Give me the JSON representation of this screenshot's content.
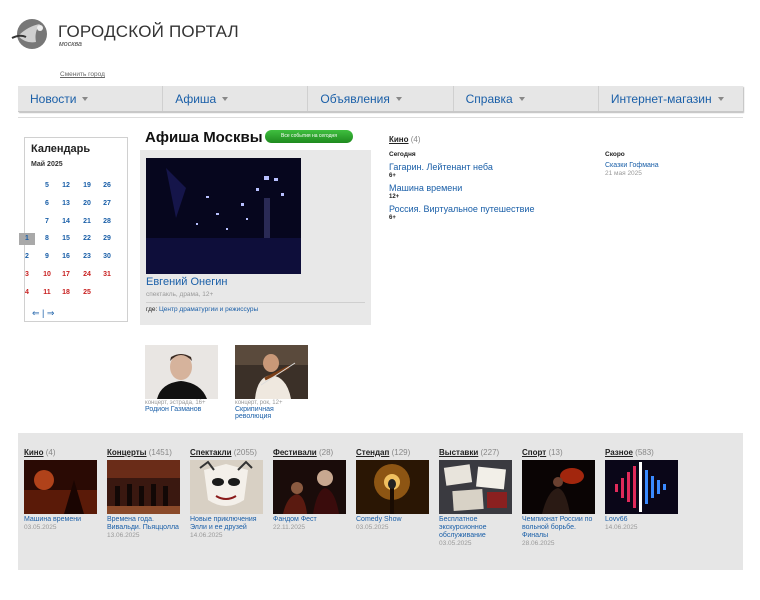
{
  "header": {
    "site_title": "ГОРОДСКОЙ ПОРТАЛ",
    "city": "москва",
    "change_city": "Сменить город"
  },
  "nav": {
    "items": [
      {
        "label": "Новости"
      },
      {
        "label": "Афиша"
      },
      {
        "label": "Объявления"
      },
      {
        "label": "Справка"
      },
      {
        "label": "Интернет-магазин"
      }
    ]
  },
  "calendar": {
    "title": "Календарь",
    "month": "Май 2025",
    "rows": [
      [
        "",
        "5",
        "12",
        "19",
        "26"
      ],
      [
        "",
        "6",
        "13",
        "20",
        "27"
      ],
      [
        "",
        "7",
        "14",
        "21",
        "28"
      ],
      [
        "1",
        "8",
        "15",
        "22",
        "29"
      ],
      [
        "2",
        "9",
        "16",
        "23",
        "30"
      ],
      [
        "3",
        "10",
        "17",
        "24",
        "31"
      ],
      [
        "4",
        "11",
        "18",
        "25",
        ""
      ]
    ],
    "selected": "1",
    "nav_symbol": "⇐ | ⇒"
  },
  "afisha": {
    "title": "Афиша Москвы",
    "all_today": "Все события на сегодня",
    "feature": {
      "title": "Евгений Онегин",
      "meta": "спектакль, драма, 12+",
      "venue_label": "где:",
      "venue": "Центр драматургии и режиссуры"
    }
  },
  "kino": {
    "label": "Кино",
    "count": "(4)",
    "today_label": "Сегодня",
    "films": [
      {
        "title": "Гагарин. Лейтенант неба",
        "age": "6+"
      },
      {
        "title": "Машина времени",
        "age": "12+"
      },
      {
        "title": "Россия. Виртуальное путешествие",
        "age": "6+"
      }
    ],
    "soon_label": "Скоро",
    "soon_title": "Сказки Гофмана",
    "soon_date": "21 мая 2025"
  },
  "small_events": [
    {
      "meta": "концерт, эстрада, 16+",
      "name": "Родион Газманов"
    },
    {
      "meta": "концерт, рок, 12+",
      "name": "Скрипичная революция"
    }
  ],
  "categories": [
    {
      "label": "Кино",
      "count": "(4)",
      "name": "Машина времени",
      "date": "03.05.2025"
    },
    {
      "label": "Концерты",
      "count": "(1451)",
      "name": "Времена года. Вивальди. Пьяццолла",
      "date": "13.06.2025"
    },
    {
      "label": "Спектакли",
      "count": "(2055)",
      "name": "Новые приключения Элли и ее друзей",
      "date": "14.06.2025"
    },
    {
      "label": "Фестивали",
      "count": "(28)",
      "name": "Фандом Фест",
      "date": "22.11.2025"
    },
    {
      "label": "Стендап",
      "count": "(129)",
      "name": "Comedy Show",
      "date": "03.05.2025"
    },
    {
      "label": "Выставки",
      "count": "(227)",
      "name": "Бесплатное экскурсионное обслуживание",
      "date": "03.05.2025"
    },
    {
      "label": "Спорт",
      "count": "(13)",
      "name": "Чемпионат России по вольной борьбе. Финалы",
      "date": "28.06.2025"
    },
    {
      "label": "Разное",
      "count": "(583)",
      "name": "Lovv66",
      "date": "14.06.2025"
    }
  ]
}
